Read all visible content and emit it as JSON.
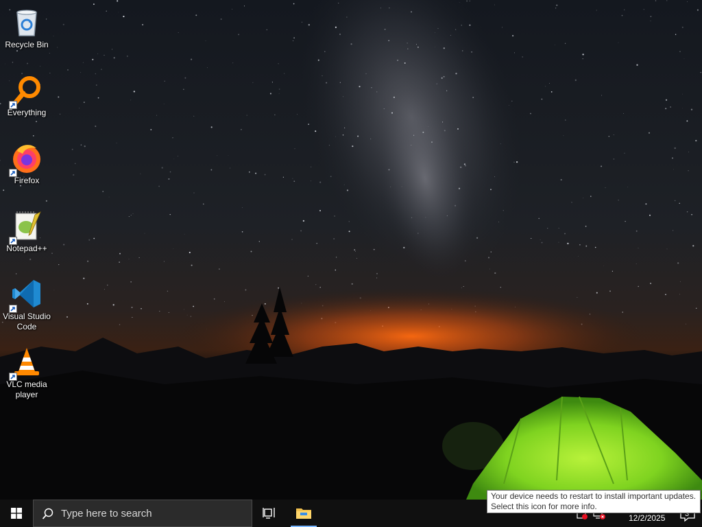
{
  "desktop": {
    "icons": [
      {
        "label": "Recycle Bin",
        "icon": "recycle-bin-icon",
        "shortcut": false
      },
      {
        "label": "Everything",
        "icon": "everything-icon",
        "shortcut": true
      },
      {
        "label": "Firefox",
        "icon": "firefox-icon",
        "shortcut": true
      },
      {
        "label": "Notepad++",
        "icon": "notepad-plus-plus-icon",
        "shortcut": true
      },
      {
        "label": "Visual Studio Code",
        "icon": "vscode-icon",
        "shortcut": true
      },
      {
        "label": "VLC media player",
        "icon": "vlc-icon",
        "shortcut": true
      }
    ],
    "wallpaper": "night-sky-milky-way-with-green-tent"
  },
  "taskbar": {
    "search_placeholder": "Type here to search",
    "pinned": [
      {
        "name": "task-view",
        "icon": "task-view-icon"
      },
      {
        "name": "file-explorer",
        "icon": "folder-icon",
        "active": true
      }
    ],
    "tray": {
      "date": "12/2/2025",
      "notification_count": "3",
      "icons": [
        "update-alert-icon",
        "network-disconnected-icon"
      ]
    }
  },
  "tooltip": {
    "line1": "Your device needs to restart to install important updates.",
    "line2": "Select this icon for more info."
  },
  "colors": {
    "taskbar_bg": "#101010",
    "accent": "#7ab7ff",
    "tent_green": "#7fd320",
    "horizon_glow": "#ff6a10"
  }
}
